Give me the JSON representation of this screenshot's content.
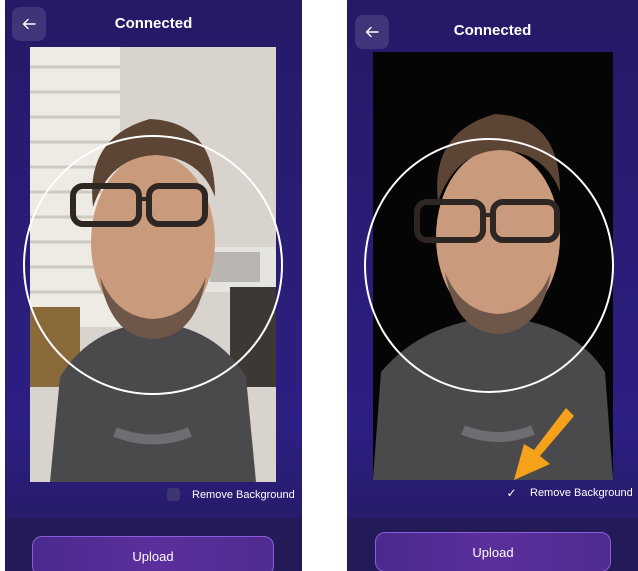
{
  "screens": [
    {
      "header": {
        "title": "Connected"
      },
      "remove_background": {
        "label": "Remove Background",
        "checked": false,
        "mark": ""
      },
      "upload": {
        "label": "Upload"
      }
    },
    {
      "header": {
        "title": "Connected"
      },
      "remove_background": {
        "label": "Remove Background",
        "checked": true,
        "mark": "✓"
      },
      "upload": {
        "label": "Upload"
      }
    }
  ],
  "colors": {
    "panel_background": "#2a1d78",
    "upload_border": "#8b5bd8",
    "highlight_arrow": "#f5a21a"
  },
  "icons": {
    "back": "arrow-left-icon",
    "highlight": "arrow-pointer-icon"
  }
}
